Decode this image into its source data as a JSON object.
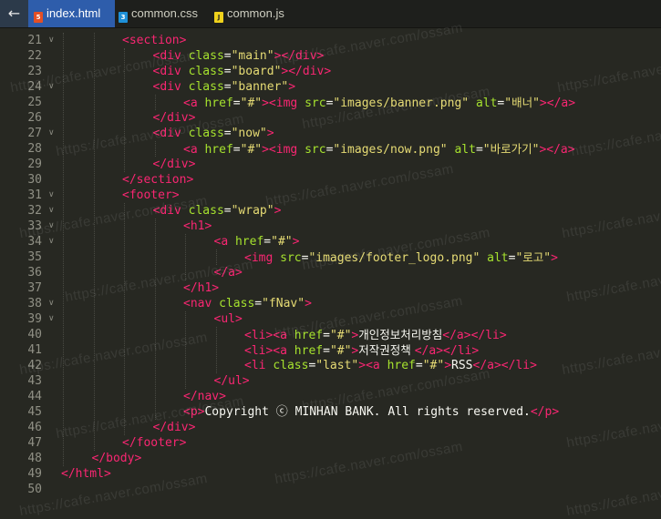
{
  "tabs": [
    {
      "label": "index.html",
      "icon": "html-file-icon",
      "active": true
    },
    {
      "label": "common.css",
      "icon": "css-file-icon",
      "active": false
    },
    {
      "label": "common.js",
      "icon": "js-file-icon",
      "active": false
    }
  ],
  "icons": {
    "back": "←",
    "html": "5",
    "css": "3",
    "js": "J"
  },
  "watermark": "https://cafe.naver.com/ossam",
  "lines": [
    {
      "n": "21",
      "fold": true,
      "i": 2,
      "tokens": [
        [
          "t",
          "<section>"
        ]
      ]
    },
    {
      "n": "22",
      "fold": false,
      "i": 3,
      "tokens": [
        [
          "t",
          "<div "
        ],
        [
          "a",
          "class"
        ],
        [
          "p",
          "="
        ],
        [
          "s",
          "\"main\""
        ],
        [
          "t",
          "></div>"
        ]
      ]
    },
    {
      "n": "23",
      "fold": false,
      "i": 3,
      "tokens": [
        [
          "t",
          "<div "
        ],
        [
          "a",
          "class"
        ],
        [
          "p",
          "="
        ],
        [
          "s",
          "\"board\""
        ],
        [
          "t",
          "></div>"
        ]
      ]
    },
    {
      "n": "24",
      "fold": true,
      "i": 3,
      "tokens": [
        [
          "t",
          "<div "
        ],
        [
          "a",
          "class"
        ],
        [
          "p",
          "="
        ],
        [
          "s",
          "\"banner\""
        ],
        [
          "t",
          ">"
        ]
      ]
    },
    {
      "n": "25",
      "fold": false,
      "i": 4,
      "tokens": [
        [
          "t",
          "<a "
        ],
        [
          "a",
          "href"
        ],
        [
          "p",
          "="
        ],
        [
          "s",
          "\"#\""
        ],
        [
          "t",
          "><img "
        ],
        [
          "a",
          "src"
        ],
        [
          "p",
          "="
        ],
        [
          "s",
          "\"images/banner.png\""
        ],
        [
          "p",
          " "
        ],
        [
          "a",
          "alt"
        ],
        [
          "p",
          "="
        ],
        [
          "s",
          "\""
        ],
        [
          "skr",
          "배너"
        ],
        [
          "s",
          "\""
        ],
        [
          "t",
          "></a>"
        ]
      ]
    },
    {
      "n": "26",
      "fold": false,
      "i": 3,
      "tokens": [
        [
          "t",
          "</div>"
        ]
      ]
    },
    {
      "n": "27",
      "fold": true,
      "i": 3,
      "tokens": [
        [
          "t",
          "<div "
        ],
        [
          "a",
          "class"
        ],
        [
          "p",
          "="
        ],
        [
          "s",
          "\"now\""
        ],
        [
          "t",
          ">"
        ]
      ]
    },
    {
      "n": "28",
      "fold": false,
      "i": 4,
      "tokens": [
        [
          "t",
          "<a "
        ],
        [
          "a",
          "href"
        ],
        [
          "p",
          "="
        ],
        [
          "s",
          "\"#\""
        ],
        [
          "t",
          "><img "
        ],
        [
          "a",
          "src"
        ],
        [
          "p",
          "="
        ],
        [
          "s",
          "\"images/now.png\""
        ],
        [
          "p",
          " "
        ],
        [
          "a",
          "alt"
        ],
        [
          "p",
          "="
        ],
        [
          "s",
          "\""
        ],
        [
          "skr",
          "바로가기"
        ],
        [
          "s",
          "\""
        ],
        [
          "t",
          "></a>"
        ]
      ]
    },
    {
      "n": "29",
      "fold": false,
      "i": 3,
      "tokens": [
        [
          "t",
          "</div>"
        ]
      ]
    },
    {
      "n": "30",
      "fold": false,
      "i": 2,
      "tokens": [
        [
          "t",
          "</section>"
        ]
      ]
    },
    {
      "n": "31",
      "fold": true,
      "i": 2,
      "tokens": [
        [
          "t",
          "<footer>"
        ]
      ]
    },
    {
      "n": "32",
      "fold": true,
      "i": 3,
      "tokens": [
        [
          "t",
          "<div "
        ],
        [
          "a",
          "class"
        ],
        [
          "p",
          "="
        ],
        [
          "s",
          "\"wrap\""
        ],
        [
          "t",
          ">"
        ]
      ]
    },
    {
      "n": "33",
      "fold": true,
      "i": 4,
      "tokens": [
        [
          "t",
          "<h1>"
        ]
      ]
    },
    {
      "n": "34",
      "fold": true,
      "i": 5,
      "tokens": [
        [
          "t",
          "<a "
        ],
        [
          "a",
          "href"
        ],
        [
          "p",
          "="
        ],
        [
          "s",
          "\"#\""
        ],
        [
          "t",
          ">"
        ]
      ]
    },
    {
      "n": "35",
      "fold": false,
      "i": 6,
      "tokens": [
        [
          "t",
          "<img "
        ],
        [
          "a",
          "src"
        ],
        [
          "p",
          "="
        ],
        [
          "s",
          "\"images/footer_logo.png\""
        ],
        [
          "p",
          " "
        ],
        [
          "a",
          "alt"
        ],
        [
          "p",
          "="
        ],
        [
          "s",
          "\""
        ],
        [
          "skr",
          "로고"
        ],
        [
          "s",
          "\""
        ],
        [
          "t",
          ">"
        ]
      ]
    },
    {
      "n": "36",
      "fold": false,
      "i": 5,
      "tokens": [
        [
          "t",
          "</a>"
        ]
      ]
    },
    {
      "n": "37",
      "fold": false,
      "i": 4,
      "tokens": [
        [
          "t",
          "</h1>"
        ]
      ]
    },
    {
      "n": "38",
      "fold": true,
      "i": 4,
      "tokens": [
        [
          "t",
          "<nav "
        ],
        [
          "a",
          "class"
        ],
        [
          "p",
          "="
        ],
        [
          "s",
          "\"fNav\""
        ],
        [
          "t",
          ">"
        ]
      ]
    },
    {
      "n": "39",
      "fold": true,
      "i": 5,
      "tokens": [
        [
          "t",
          "<ul>"
        ]
      ]
    },
    {
      "n": "40",
      "fold": false,
      "i": 6,
      "tokens": [
        [
          "t",
          "<li><a "
        ],
        [
          "a",
          "href"
        ],
        [
          "p",
          "="
        ],
        [
          "s",
          "\"#\""
        ],
        [
          "t",
          ">"
        ],
        [
          "pkr",
          "개인정보처리방침"
        ],
        [
          "t",
          "</a></li>"
        ]
      ]
    },
    {
      "n": "41",
      "fold": false,
      "i": 6,
      "tokens": [
        [
          "t",
          "<li><a "
        ],
        [
          "a",
          "href"
        ],
        [
          "p",
          "="
        ],
        [
          "s",
          "\"#\""
        ],
        [
          "t",
          ">"
        ],
        [
          "pkr",
          "저작권정책 "
        ],
        [
          "t",
          "</a></li>"
        ]
      ]
    },
    {
      "n": "42",
      "fold": false,
      "i": 6,
      "tokens": [
        [
          "t",
          "<li "
        ],
        [
          "a",
          "class"
        ],
        [
          "p",
          "="
        ],
        [
          "s",
          "\"last\""
        ],
        [
          "t",
          "><a "
        ],
        [
          "a",
          "href"
        ],
        [
          "p",
          "="
        ],
        [
          "s",
          "\"#\""
        ],
        [
          "t",
          ">"
        ],
        [
          "p",
          "RSS"
        ],
        [
          "t",
          "</a></li>"
        ]
      ]
    },
    {
      "n": "43",
      "fold": false,
      "i": 5,
      "tokens": [
        [
          "t",
          "</ul>"
        ]
      ]
    },
    {
      "n": "44",
      "fold": false,
      "i": 4,
      "tokens": [
        [
          "t",
          "</nav>"
        ]
      ]
    },
    {
      "n": "45",
      "fold": false,
      "i": 4,
      "tokens": [
        [
          "t",
          "<p>"
        ],
        [
          "p",
          "Copyright ⓒ MINHAN BANK. All rights reserved."
        ],
        [
          "t",
          "</p>"
        ]
      ]
    },
    {
      "n": "46",
      "fold": false,
      "i": 3,
      "tokens": [
        [
          "t",
          "</div>"
        ]
      ]
    },
    {
      "n": "47",
      "fold": false,
      "i": 2,
      "tokens": [
        [
          "t",
          "</footer>"
        ]
      ]
    },
    {
      "n": "48",
      "fold": false,
      "i": 1,
      "tokens": [
        [
          "t",
          "</body>"
        ]
      ]
    },
    {
      "n": "49",
      "fold": false,
      "i": 0,
      "tokens": [
        [
          "t",
          "</html>"
        ]
      ]
    },
    {
      "n": "50",
      "fold": false,
      "i": 0,
      "tokens": []
    }
  ]
}
